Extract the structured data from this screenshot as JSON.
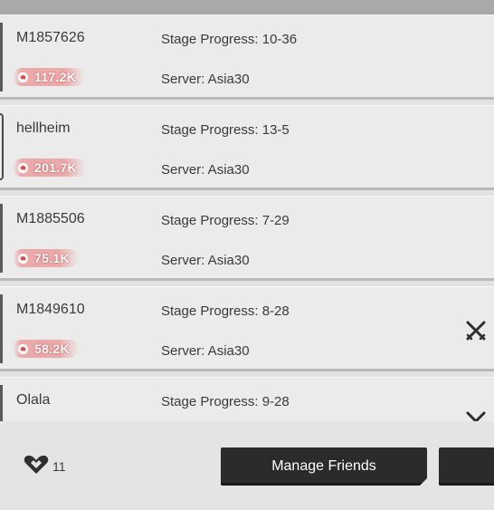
{
  "friends": [
    {
      "name": "M1857626",
      "power": "117.2K",
      "stage": "Stage Progress: 10-36",
      "server": "Server: Asia30",
      "action_icon": ""
    },
    {
      "name": "hellheim",
      "power": "201.7K",
      "stage": "Stage Progress: 13-5",
      "server": "Server: Asia30",
      "action_icon": ""
    },
    {
      "name": "M1885506",
      "power": "75.1K",
      "stage": "Stage Progress: 7-29",
      "server": "Server: Asia30",
      "action_icon": ""
    },
    {
      "name": "M1849610",
      "power": "58.2K",
      "stage": "Stage Progress: 8-28",
      "server": "Server: Asia30",
      "action_icon": "crossed-swords-icon"
    },
    {
      "name": "Olala",
      "power": "",
      "stage": "Stage Progress: 9-28",
      "server": "",
      "action_icon": "crossed-swords-icon"
    }
  ],
  "footer": {
    "friend_count": "11",
    "manage_button": "Manage Friends",
    "second_button": ""
  },
  "colors": {
    "power_badge": "#e87272",
    "button_bg": "#2b2b2b",
    "row_bg": "#ebebeb"
  }
}
